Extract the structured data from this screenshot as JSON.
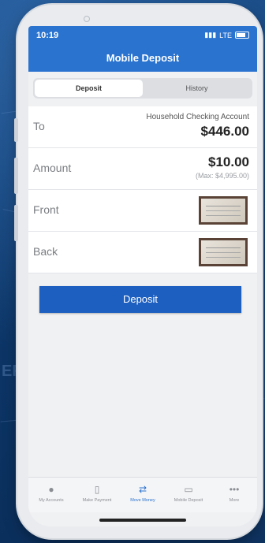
{
  "background_text": "ER",
  "status_bar": {
    "time": "10:19",
    "network": "LTE"
  },
  "nav": {
    "title": "Mobile Deposit"
  },
  "segments": [
    {
      "label": "Deposit",
      "active": true
    },
    {
      "label": "History",
      "active": false
    }
  ],
  "form": {
    "to": {
      "label": "To",
      "account": "Household Checking Account",
      "balance": "$446.00"
    },
    "amount": {
      "label": "Amount",
      "value": "$10.00",
      "max": "(Max: $4,995.00)"
    },
    "front": {
      "label": "Front"
    },
    "back": {
      "label": "Back"
    }
  },
  "deposit_button": "Deposit",
  "tabbar": [
    {
      "label": "My Accounts",
      "icon": "dollar-icon"
    },
    {
      "label": "Make Payment",
      "icon": "receipt-icon"
    },
    {
      "label": "Move Money",
      "icon": "transfer-icon",
      "active": true
    },
    {
      "label": "Mobile Deposit",
      "icon": "check-icon"
    },
    {
      "label": "More",
      "icon": "more-icon"
    }
  ],
  "colors": {
    "primary": "#2a73cf",
    "button": "#1d5fc0",
    "page_bg": "#0e3d73"
  }
}
